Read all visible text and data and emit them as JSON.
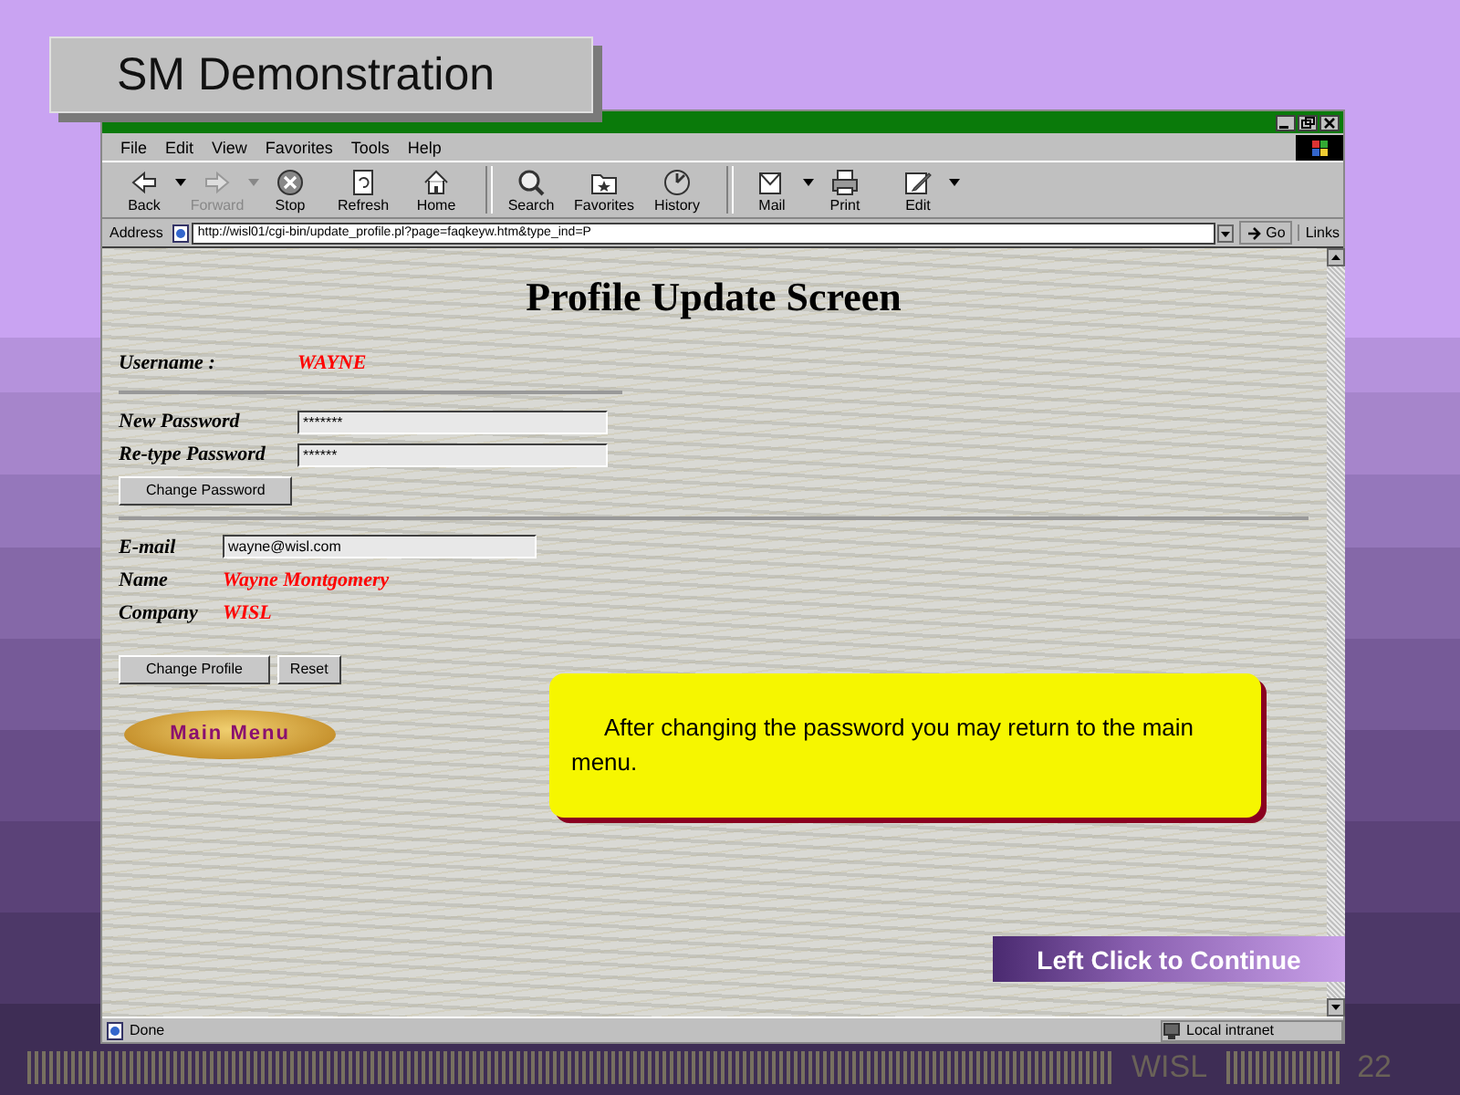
{
  "slide": {
    "title": "SM Demonstration",
    "continue_button": "Left Click to Continue",
    "footer": "WISL",
    "page_number": "22"
  },
  "browser": {
    "menu": [
      "File",
      "Edit",
      "View",
      "Favorites",
      "Tools",
      "Help"
    ],
    "toolbar_groups": [
      [
        {
          "kind": "back",
          "label": "Back",
          "disabled": false,
          "dropdown": true
        },
        {
          "kind": "forward",
          "label": "Forward",
          "disabled": true,
          "dropdown": true
        },
        {
          "kind": "stop",
          "label": "Stop",
          "disabled": false,
          "dropdown": false
        },
        {
          "kind": "refresh",
          "label": "Refresh",
          "disabled": false,
          "dropdown": false
        },
        {
          "kind": "home",
          "label": "Home",
          "disabled": false,
          "dropdown": false
        }
      ],
      [
        {
          "kind": "search",
          "label": "Search",
          "disabled": false,
          "dropdown": false
        },
        {
          "kind": "favorites",
          "label": "Favorites",
          "disabled": false,
          "dropdown": false
        },
        {
          "kind": "history",
          "label": "History",
          "disabled": false,
          "dropdown": false
        }
      ],
      [
        {
          "kind": "mail",
          "label": "Mail",
          "disabled": false,
          "dropdown": true
        },
        {
          "kind": "print",
          "label": "Print",
          "disabled": false,
          "dropdown": false
        },
        {
          "kind": "edit",
          "label": "Edit",
          "disabled": false,
          "dropdown": true
        }
      ]
    ],
    "address": {
      "label": "Address",
      "url": "http://wisl01/cgi-bin/update_profile.pl?page=faqkeyw.htm&type_ind=P"
    },
    "go": "Go",
    "links": "Links",
    "status": {
      "text": "Done",
      "zone": "Local intranet"
    }
  },
  "page": {
    "heading": "Profile Update Screen",
    "username": {
      "label": "Username :",
      "value": "WAYNE"
    },
    "password_fields": [
      {
        "label": "New Password",
        "value": "*******"
      },
      {
        "label": "Re-type Password",
        "value": "******"
      }
    ],
    "change_password": "Change Password",
    "email": {
      "label": "E-mail",
      "value": "wayne@wisl.com"
    },
    "info": [
      {
        "label": "Name",
        "value": "Wayne Montgomery"
      },
      {
        "label": "Company",
        "value": "WISL"
      }
    ],
    "buttons": [
      "Change Profile",
      "Reset"
    ],
    "main_menu": "Main Menu",
    "callout": "After changing the password you may return to the main menu."
  }
}
